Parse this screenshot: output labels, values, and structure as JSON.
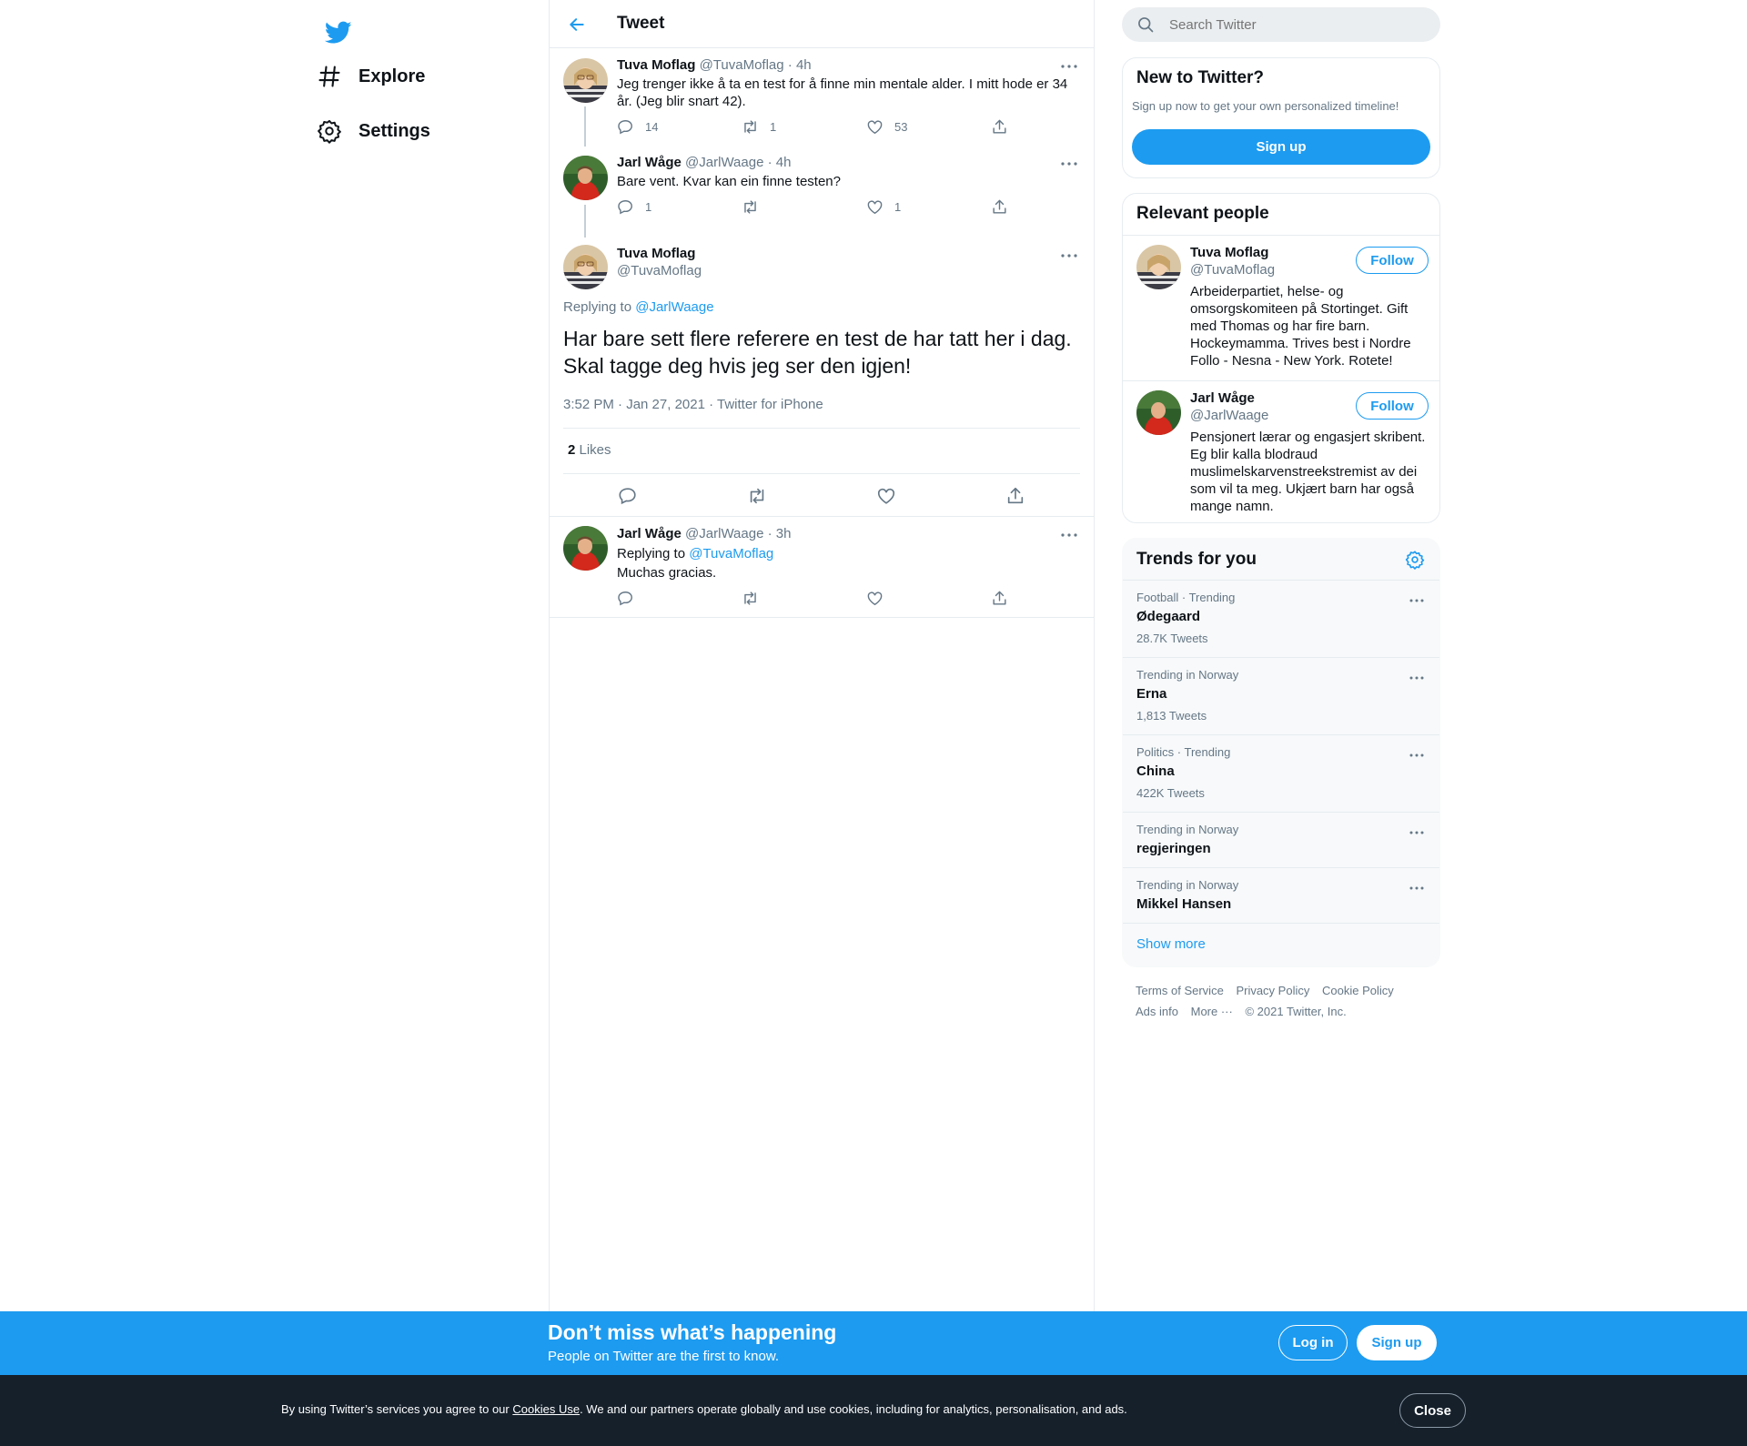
{
  "nav": {
    "items": [
      {
        "label": "Explore",
        "icon": "hashtag-icon"
      },
      {
        "label": "Settings",
        "icon": "gear-icon"
      }
    ]
  },
  "header": {
    "title": "Tweet"
  },
  "thread": [
    {
      "name": "Tuva Moflag",
      "handle": "@TuvaMoflag",
      "time": "· 4h",
      "text": "Jeg trenger ikke å ta en test for å finne min mentale alder. I mitt hode er 34 år. (Jeg blir snart 42).",
      "replies": "14",
      "retweets": "1",
      "likes": "53"
    },
    {
      "name": "Jarl Wåge",
      "handle": "@JarlWaage",
      "time": "· 4h",
      "text": "Bare vent. Kvar kan ein finne testen?",
      "replies": "1",
      "retweets": "",
      "likes": "1"
    }
  ],
  "focus": {
    "name": "Tuva Moflag",
    "handle": "@TuvaMoflag",
    "replying_prefix": "Replying to ",
    "replying_to": "@JarlWaage",
    "text": "Har bare sett flere referere en test de har tatt her i dag. Skal tagge deg hvis jeg ser den igjen!",
    "meta": "3:52 PM · Jan 27, 2021 · Twitter for iPhone",
    "likes_count": "2",
    "likes_label": " Likes"
  },
  "reply": {
    "name": "Jarl Wåge",
    "handle": "@JarlWaage",
    "time": "· 3h",
    "replying_prefix": "Replying to ",
    "replying_to": "@TuvaMoflag",
    "text": "Muchas gracias."
  },
  "search": {
    "placeholder": "Search Twitter"
  },
  "new_to_twitter": {
    "title": "New to Twitter?",
    "subtitle": "Sign up now to get your own personalized timeline!",
    "button": "Sign up"
  },
  "relevant": {
    "title": "Relevant people",
    "people": [
      {
        "name": "Tuva Moflag",
        "handle": "@TuvaMoflag",
        "bio": "Arbeiderpartiet, helse- og omsorgskomiteen på Stortinget. Gift med Thomas og har fire barn. Hockeymamma. Trives best i Nordre Follo - Nesna - New York. Rotete!",
        "button": "Follow"
      },
      {
        "name": "Jarl Wåge",
        "handle": "@JarlWaage",
        "bio": "Pensjonert lærar og engasjert skribent. Eg blir kalla blodraud muslimelskarvenstreekstremist av dei som vil ta meg. Ukjært barn har også mange namn.",
        "button": "Follow"
      }
    ]
  },
  "trends": {
    "title": "Trends for you",
    "items": [
      {
        "context": "Football · Trending",
        "name": "Ødegaard",
        "count": "28.7K Tweets"
      },
      {
        "context": "Trending in Norway",
        "name": "Erna",
        "count": "1,813 Tweets"
      },
      {
        "context": "Politics · Trending",
        "name": "China",
        "count": "422K Tweets"
      },
      {
        "context": "Trending in Norway",
        "name": "regjeringen",
        "count": ""
      },
      {
        "context": "Trending in Norway",
        "name": "Mikkel Hansen",
        "count": ""
      }
    ],
    "show_more": "Show more"
  },
  "footer": {
    "links": [
      "Terms of Service",
      "Privacy Policy",
      "Cookie Policy",
      "Ads info",
      "More ···"
    ],
    "copyright": "© 2021 Twitter, Inc."
  },
  "banner": {
    "title": "Don’t miss what’s happening",
    "subtitle": "People on Twitter are the first to know.",
    "login": "Log in",
    "signup": "Sign up"
  },
  "cookie": {
    "prefix": "By using Twitter’s services you agree to our ",
    "link": "Cookies Use",
    "suffix": ". We and our partners operate globally and use cookies, including for analytics, personalisation, and ads.",
    "close": "Close"
  },
  "colors": {
    "accent": "#1d9bf0",
    "cookie_bg": "#15202b",
    "text_gray": "#657786"
  }
}
